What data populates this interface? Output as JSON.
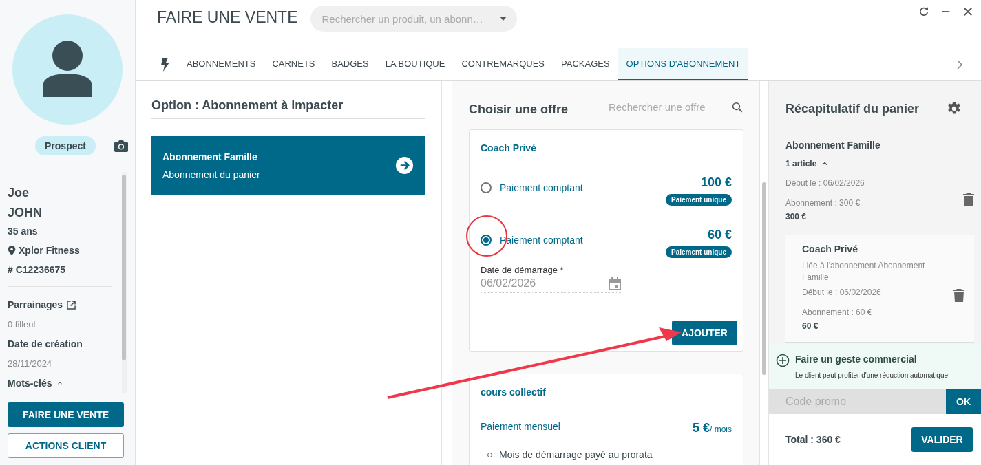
{
  "client": {
    "status": "Prospect",
    "first_name": "Joe",
    "last_name": "JOHN",
    "age": "35 ans",
    "club": "Xplor Fitness",
    "number": "# C12236675",
    "fields": [
      {
        "label": "Parrainages",
        "value": "0 filleul",
        "kind": "link"
      },
      {
        "label": "Date de création",
        "value": "28/11/2024",
        "kind": "plain"
      }
    ],
    "keywords_label": "Mots-clés",
    "keywords_expanded": true
  },
  "sidebar_buttons": [
    {
      "label": "FAIRE UNE VENTE",
      "kind": "primary"
    },
    {
      "label": "ACTIONS CLIENT",
      "kind": "outline"
    }
  ],
  "header": {
    "title": "FAIRE UNE VENTE",
    "search_placeholder": "Rechercher un produit, un abonn…"
  },
  "tabs": [
    {
      "label": "ABONNEMENTS",
      "selected": false
    },
    {
      "label": "CARNETS",
      "selected": false
    },
    {
      "label": "BADGES",
      "selected": false
    },
    {
      "label": "LA BOUTIQUE",
      "selected": false
    },
    {
      "label": "CONTREMARQUES",
      "selected": false
    },
    {
      "label": "PACKAGES",
      "selected": false
    },
    {
      "label": "OPTIONS D'ABONNEMENT",
      "selected": true
    }
  ],
  "impact": {
    "title": "Option : Abonnement à impacter",
    "subscription": {
      "name": "Abonnement Famille",
      "subtitle": "Abonnement du panier"
    }
  },
  "offers": {
    "title": "Choisir une offre",
    "search_placeholder": "Rechercher une offre",
    "cards": [
      {
        "name": "Coach Privé",
        "options": [
          {
            "kind": "radio",
            "label": "Paiement comptant",
            "price": "100 €",
            "badge": "Paiement unique",
            "selected": false
          },
          {
            "kind": "radio",
            "label": "Paiement comptant",
            "price": "60 €",
            "badge": "Paiement unique",
            "selected": true
          }
        ],
        "date_label": "Date de démarrage *",
        "date_value": "06/02/2026",
        "button": "AJOUTER"
      },
      {
        "name": "cours collectif",
        "options": [
          {
            "kind": "plain",
            "label": "Paiement mensuel",
            "price": "5 €",
            "unit": "/ mois"
          }
        ],
        "notes": [
          "Mois de démarrage payé au prorata"
        ]
      }
    ]
  },
  "cart": {
    "title": "Récapitulatif du panier",
    "items": [
      {
        "name": "Abonnement Famille",
        "count": "1 article",
        "expanded": true,
        "start": "Début le : 06/02/2026",
        "detail": "Abonnement : 300 €",
        "total": "300 €",
        "children": [
          {
            "name": "Coach Privé",
            "link": "Liée à l'abonnement Abonnement Famille",
            "start": "Début le : 06/02/2026",
            "detail": "Abonnement : 60 €",
            "total": "60 €"
          }
        ]
      }
    ],
    "gesture": {
      "title": "Faire un geste commercial",
      "subtitle": "Le client peut profiter d'une réduction automatique"
    },
    "promo": {
      "placeholder": "Code promo",
      "button": "OK"
    },
    "total": "Total : 360 €",
    "validate": "VALIDER"
  }
}
